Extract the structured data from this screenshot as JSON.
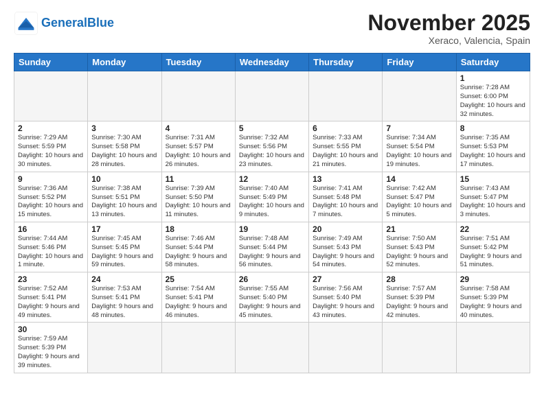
{
  "header": {
    "logo_general": "General",
    "logo_blue": "Blue",
    "month_title": "November 2025",
    "location": "Xeraco, Valencia, Spain"
  },
  "weekdays": [
    "Sunday",
    "Monday",
    "Tuesday",
    "Wednesday",
    "Thursday",
    "Friday",
    "Saturday"
  ],
  "weeks": [
    [
      {
        "day": "",
        "info": ""
      },
      {
        "day": "",
        "info": ""
      },
      {
        "day": "",
        "info": ""
      },
      {
        "day": "",
        "info": ""
      },
      {
        "day": "",
        "info": ""
      },
      {
        "day": "",
        "info": ""
      },
      {
        "day": "1",
        "info": "Sunrise: 7:28 AM\nSunset: 6:00 PM\nDaylight: 10 hours and 32 minutes."
      }
    ],
    [
      {
        "day": "2",
        "info": "Sunrise: 7:29 AM\nSunset: 5:59 PM\nDaylight: 10 hours and 30 minutes."
      },
      {
        "day": "3",
        "info": "Sunrise: 7:30 AM\nSunset: 5:58 PM\nDaylight: 10 hours and 28 minutes."
      },
      {
        "day": "4",
        "info": "Sunrise: 7:31 AM\nSunset: 5:57 PM\nDaylight: 10 hours and 26 minutes."
      },
      {
        "day": "5",
        "info": "Sunrise: 7:32 AM\nSunset: 5:56 PM\nDaylight: 10 hours and 23 minutes."
      },
      {
        "day": "6",
        "info": "Sunrise: 7:33 AM\nSunset: 5:55 PM\nDaylight: 10 hours and 21 minutes."
      },
      {
        "day": "7",
        "info": "Sunrise: 7:34 AM\nSunset: 5:54 PM\nDaylight: 10 hours and 19 minutes."
      },
      {
        "day": "8",
        "info": "Sunrise: 7:35 AM\nSunset: 5:53 PM\nDaylight: 10 hours and 17 minutes."
      }
    ],
    [
      {
        "day": "9",
        "info": "Sunrise: 7:36 AM\nSunset: 5:52 PM\nDaylight: 10 hours and 15 minutes."
      },
      {
        "day": "10",
        "info": "Sunrise: 7:38 AM\nSunset: 5:51 PM\nDaylight: 10 hours and 13 minutes."
      },
      {
        "day": "11",
        "info": "Sunrise: 7:39 AM\nSunset: 5:50 PM\nDaylight: 10 hours and 11 minutes."
      },
      {
        "day": "12",
        "info": "Sunrise: 7:40 AM\nSunset: 5:49 PM\nDaylight: 10 hours and 9 minutes."
      },
      {
        "day": "13",
        "info": "Sunrise: 7:41 AM\nSunset: 5:48 PM\nDaylight: 10 hours and 7 minutes."
      },
      {
        "day": "14",
        "info": "Sunrise: 7:42 AM\nSunset: 5:47 PM\nDaylight: 10 hours and 5 minutes."
      },
      {
        "day": "15",
        "info": "Sunrise: 7:43 AM\nSunset: 5:47 PM\nDaylight: 10 hours and 3 minutes."
      }
    ],
    [
      {
        "day": "16",
        "info": "Sunrise: 7:44 AM\nSunset: 5:46 PM\nDaylight: 10 hours and 1 minute."
      },
      {
        "day": "17",
        "info": "Sunrise: 7:45 AM\nSunset: 5:45 PM\nDaylight: 9 hours and 59 minutes."
      },
      {
        "day": "18",
        "info": "Sunrise: 7:46 AM\nSunset: 5:44 PM\nDaylight: 9 hours and 58 minutes."
      },
      {
        "day": "19",
        "info": "Sunrise: 7:48 AM\nSunset: 5:44 PM\nDaylight: 9 hours and 56 minutes."
      },
      {
        "day": "20",
        "info": "Sunrise: 7:49 AM\nSunset: 5:43 PM\nDaylight: 9 hours and 54 minutes."
      },
      {
        "day": "21",
        "info": "Sunrise: 7:50 AM\nSunset: 5:43 PM\nDaylight: 9 hours and 52 minutes."
      },
      {
        "day": "22",
        "info": "Sunrise: 7:51 AM\nSunset: 5:42 PM\nDaylight: 9 hours and 51 minutes."
      }
    ],
    [
      {
        "day": "23",
        "info": "Sunrise: 7:52 AM\nSunset: 5:41 PM\nDaylight: 9 hours and 49 minutes."
      },
      {
        "day": "24",
        "info": "Sunrise: 7:53 AM\nSunset: 5:41 PM\nDaylight: 9 hours and 48 minutes."
      },
      {
        "day": "25",
        "info": "Sunrise: 7:54 AM\nSunset: 5:41 PM\nDaylight: 9 hours and 46 minutes."
      },
      {
        "day": "26",
        "info": "Sunrise: 7:55 AM\nSunset: 5:40 PM\nDaylight: 9 hours and 45 minutes."
      },
      {
        "day": "27",
        "info": "Sunrise: 7:56 AM\nSunset: 5:40 PM\nDaylight: 9 hours and 43 minutes."
      },
      {
        "day": "28",
        "info": "Sunrise: 7:57 AM\nSunset: 5:39 PM\nDaylight: 9 hours and 42 minutes."
      },
      {
        "day": "29",
        "info": "Sunrise: 7:58 AM\nSunset: 5:39 PM\nDaylight: 9 hours and 40 minutes."
      }
    ],
    [
      {
        "day": "30",
        "info": "Sunrise: 7:59 AM\nSunset: 5:39 PM\nDaylight: 9 hours and 39 minutes."
      },
      {
        "day": "",
        "info": ""
      },
      {
        "day": "",
        "info": ""
      },
      {
        "day": "",
        "info": ""
      },
      {
        "day": "",
        "info": ""
      },
      {
        "day": "",
        "info": ""
      },
      {
        "day": "",
        "info": ""
      }
    ]
  ]
}
